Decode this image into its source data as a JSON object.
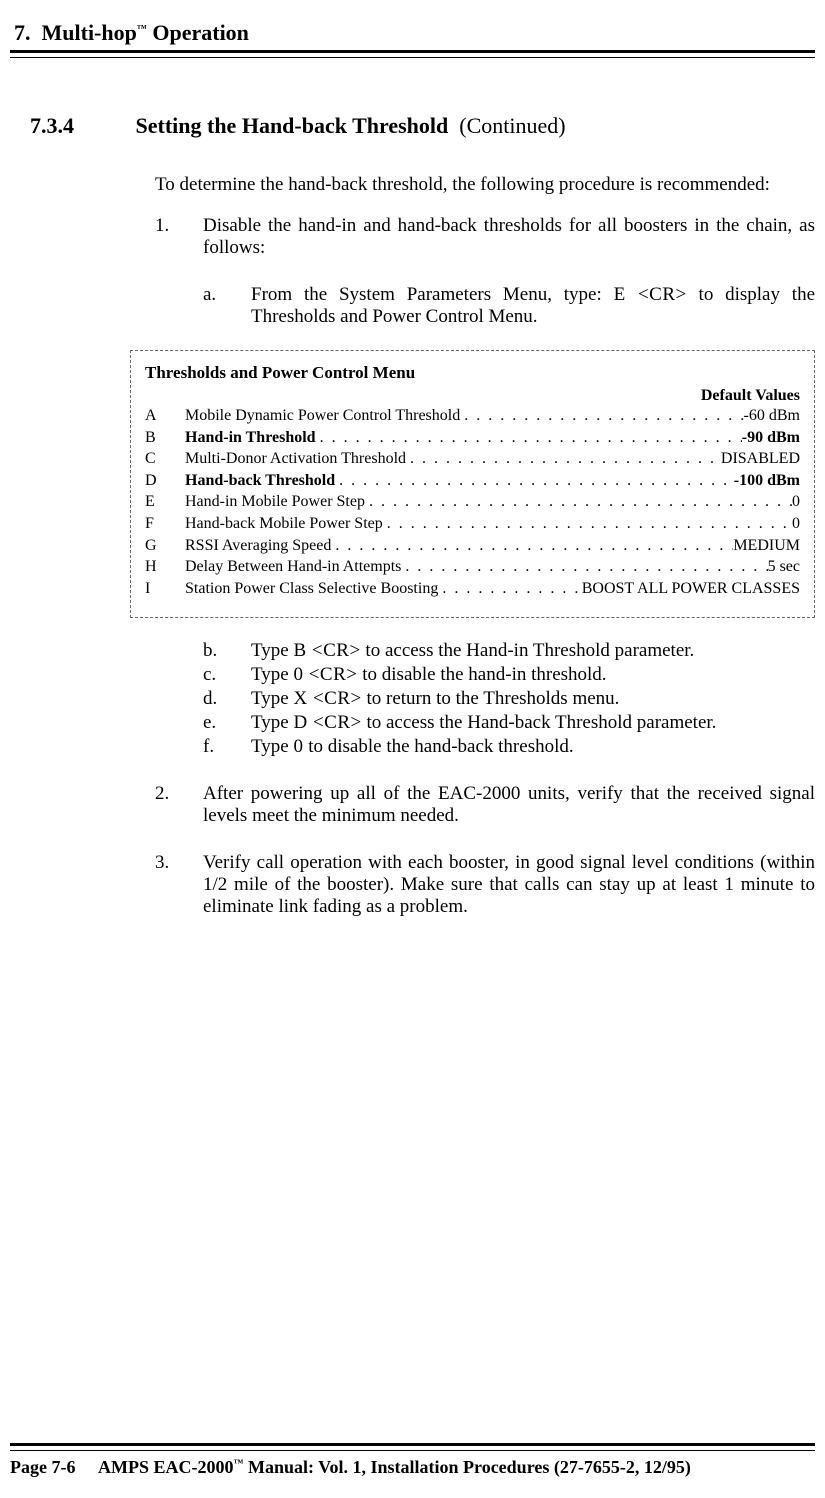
{
  "chapter": {
    "number": "7.",
    "title_pre": "Multi-hop",
    "tm": "™",
    "title_post": " Operation"
  },
  "section": {
    "number": "7.3.4",
    "title": "Setting the Hand-back Threshold",
    "continued": "(Continued)"
  },
  "intro": "To determine the hand-back threshold, the following procedure is recommended:",
  "steps": {
    "s1": {
      "num": "1.",
      "text": "Disable the hand-in and hand-back thresholds for all boosters in the chain, as follows:",
      "a": {
        "num": "a.",
        "pre": "From the System Parameters Menu, type:  ",
        "cmd": "E <CR>",
        "post": "  to display the Thresholds and Power Control Menu."
      },
      "b": {
        "num": "b.",
        "pre": "Type  ",
        "cmd": "B <CR>",
        "post": "  to access the Hand-in Threshold parameter."
      },
      "c": {
        "num": "c.",
        "pre": "Type ",
        "cmd": "0 <CR>",
        "post": " to disable the hand-in threshold."
      },
      "d": {
        "num": "d.",
        "pre": "Type  ",
        "cmd": "X <CR>",
        "post": " to return to the Thresholds menu."
      },
      "e": {
        "num": "e.",
        "pre": "Type ",
        "cmd": "D <CR>",
        "post": " to access the Hand-back Threshold parameter."
      },
      "f": {
        "num": "f.",
        "pre": "Type ",
        "cmd": "0",
        "post": " to disable the hand-back threshold."
      }
    },
    "s2": {
      "num": "2.",
      "text": "After powering up all of the EAC-2000 units, verify that the received signal levels meet the minimum needed."
    },
    "s3": {
      "num": "3.",
      "text": "Verify call operation with each booster, in good signal level conditions (within 1/2 mile of the booster).  Make sure that calls can stay up at least 1 minute to eliminate link fading as a problem."
    }
  },
  "menu": {
    "title": "Thresholds and Power Control Menu",
    "defaults_label": "Default Values",
    "rows": {
      "A": {
        "letter": "A",
        "label": "Mobile Dynamic Power Control Threshold",
        "value": "-60 dBm",
        "bold": false
      },
      "B": {
        "letter": "B",
        "label": "Hand-in Threshold",
        "value": "-90 dBm",
        "bold": true
      },
      "C": {
        "letter": "C",
        "label": "Multi-Donor Activation Threshold",
        "value": "DISABLED",
        "bold": false
      },
      "D": {
        "letter": "D",
        "label": "Hand-back Threshold",
        "value": "-100 dBm",
        "bold": true
      },
      "E": {
        "letter": "E",
        "label": "Hand-in Mobile Power Step",
        "value": "0",
        "bold": false
      },
      "F": {
        "letter": "F",
        "label": "Hand-back Mobile Power Step",
        "value": "0",
        "bold": false
      },
      "G": {
        "letter": "G",
        "label": "RSSI Averaging Speed",
        "value": "MEDIUM",
        "bold": false
      },
      "H": {
        "letter": "H",
        "label": "Delay Between Hand-in Attempts",
        "value": "5 sec",
        "bold": false
      },
      "I": {
        "letter": "I",
        "label": "Station Power Class Selective Boosting",
        "value": "BOOST ALL POWER CLASSES",
        "bold": false
      }
    }
  },
  "footer": {
    "page": "Page 7-6",
    "manual_pre": "AMPS EAC-2000",
    "tm": "™",
    "manual_post": " Manual:  Vol. 1, Installation Procedures (27-7655-2, 12/95)"
  }
}
